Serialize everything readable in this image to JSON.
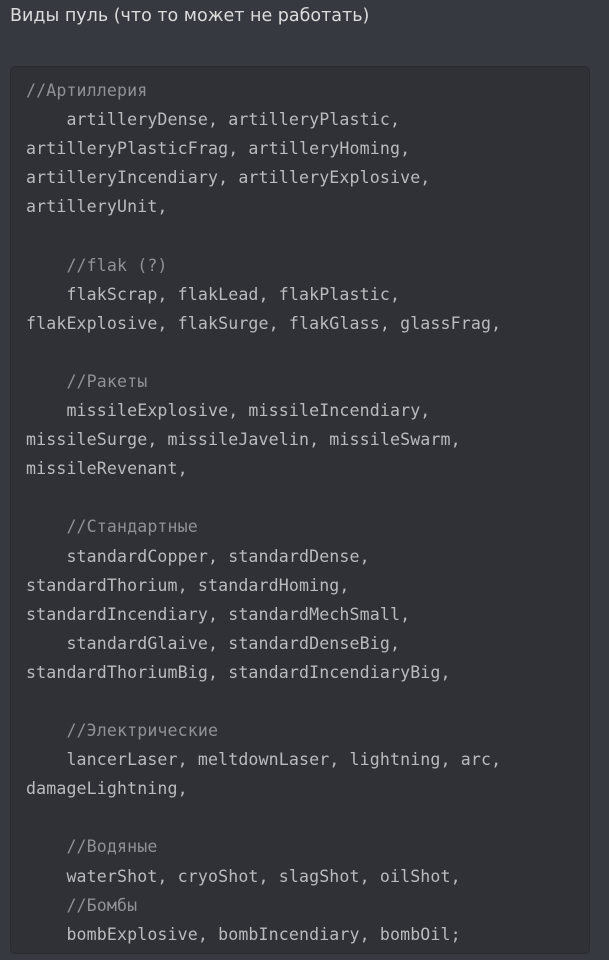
{
  "message": {
    "title": "Виды пуль (что то может не работать)"
  },
  "code_block": {
    "lines": [
      {
        "text": "//Артиллерия",
        "kind": "comment"
      },
      {
        "text": "    artilleryDense, artilleryPlastic,",
        "kind": "code"
      },
      {
        "text": "artilleryPlasticFrag, artilleryHoming,",
        "kind": "code"
      },
      {
        "text": "artilleryIncendiary, artilleryExplosive,",
        "kind": "code"
      },
      {
        "text": "artilleryUnit,",
        "kind": "code"
      },
      {
        "text": "",
        "kind": "blank"
      },
      {
        "text": "    //flak (?)",
        "kind": "comment"
      },
      {
        "text": "    flakScrap, flakLead, flakPlastic,",
        "kind": "code"
      },
      {
        "text": "flakExplosive, flakSurge, flakGlass, glassFrag,",
        "kind": "code"
      },
      {
        "text": "",
        "kind": "blank"
      },
      {
        "text": "    //Ракеты",
        "kind": "comment"
      },
      {
        "text": "    missileExplosive, missileIncendiary,",
        "kind": "code"
      },
      {
        "text": "missileSurge, missileJavelin, missileSwarm,",
        "kind": "code"
      },
      {
        "text": "missileRevenant,",
        "kind": "code"
      },
      {
        "text": "",
        "kind": "blank"
      },
      {
        "text": "    //Стандартные",
        "kind": "comment"
      },
      {
        "text": "    standardCopper, standardDense,",
        "kind": "code"
      },
      {
        "text": "standardThorium, standardHoming,",
        "kind": "code"
      },
      {
        "text": "standardIncendiary, standardMechSmall,",
        "kind": "code"
      },
      {
        "text": "    standardGlaive, standardDenseBig,",
        "kind": "code"
      },
      {
        "text": "standardThoriumBig, standardIncendiaryBig,",
        "kind": "code"
      },
      {
        "text": "",
        "kind": "blank"
      },
      {
        "text": "    //Электрические",
        "kind": "comment"
      },
      {
        "text": "    lancerLaser, meltdownLaser, lightning, arc,",
        "kind": "code"
      },
      {
        "text": "damageLightning,",
        "kind": "code"
      },
      {
        "text": "",
        "kind": "blank"
      },
      {
        "text": "    //Водяные",
        "kind": "comment"
      },
      {
        "text": "    waterShot, cryoShot, slagShot, oilShot,",
        "kind": "code"
      },
      {
        "text": "    //Бомбы",
        "kind": "comment"
      },
      {
        "text": "    bombExplosive, bombIncendiary, bombOil;",
        "kind": "code"
      }
    ]
  },
  "colors": {
    "background": "#36393f",
    "code_background": "#2f3136",
    "title_text": "#dcddde",
    "code_text": "#b9bbbe",
    "comment_text": "#8e9297"
  }
}
